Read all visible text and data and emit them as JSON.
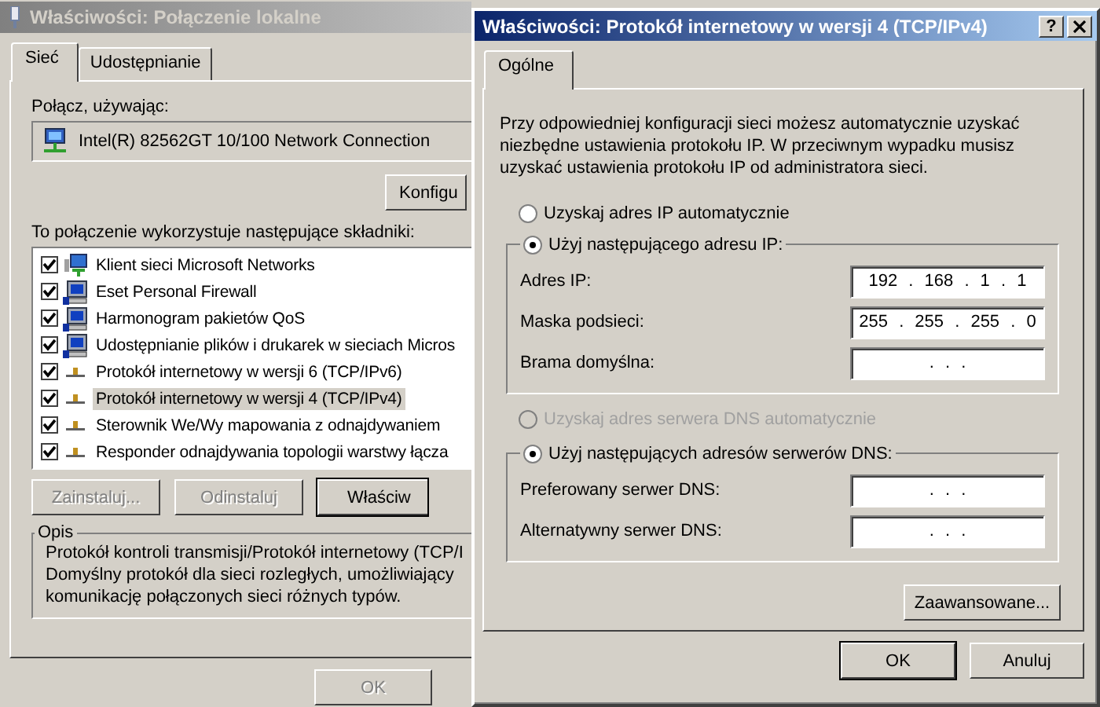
{
  "back_window": {
    "title": "Właściwości: Połączenie lokalne",
    "tabs": [
      {
        "label": "Sieć",
        "selected": true
      },
      {
        "label": "Udostępnianie",
        "selected": false
      }
    ],
    "connect_using_label": "Połącz, używając:",
    "adapter": "Intel(R) 82562GT 10/100 Network Connection",
    "configure_button": "Konfigu",
    "components_label": "To połączenie wykorzystuje następujące składniki:",
    "components": [
      {
        "kind": "client",
        "label": "Klient sieci Microsoft Networks",
        "checked": true,
        "selected": false
      },
      {
        "kind": "service",
        "label": "Eset Personal Firewall",
        "checked": true,
        "selected": false
      },
      {
        "kind": "service",
        "label": "Harmonogram pakietów QoS",
        "checked": true,
        "selected": false
      },
      {
        "kind": "service",
        "label": "Udostępnianie plików i drukarek w sieciach Micros",
        "checked": true,
        "selected": false
      },
      {
        "kind": "protocol",
        "label": "Protokół internetowy w wersji 6 (TCP/IPv6)",
        "checked": true,
        "selected": false
      },
      {
        "kind": "protocol",
        "label": "Protokół internetowy w wersji 4 (TCP/IPv4)",
        "checked": true,
        "selected": true
      },
      {
        "kind": "protocol",
        "label": "Sterownik We/Wy mapowania z odnajdywaniem",
        "checked": true,
        "selected": false
      },
      {
        "kind": "protocol",
        "label": "Responder odnajdywania topologii warstwy łącza",
        "checked": true,
        "selected": false
      }
    ],
    "buttons": [
      {
        "label": "Zainstaluj...",
        "disabled": true,
        "default": false
      },
      {
        "label": "Odinstaluj",
        "disabled": true,
        "default": false
      },
      {
        "label": "Właściw",
        "disabled": false,
        "default": true
      }
    ],
    "description": {
      "title": "Opis",
      "text": "Protokół kontroli transmisji/Protokół internetowy (TCP/I\nDomyślny protokół dla sieci rozległych, umożliwiający\nkomunikację połączonych sieci różnych typów."
    },
    "ok_button": {
      "label": "OK",
      "disabled": true
    }
  },
  "front_window": {
    "title": "Właściwości: Protokół internetowy w wersji 4 (TCP/IPv4)",
    "help_button": "?",
    "tabs": [
      {
        "label": "Ogólne",
        "selected": true
      }
    ],
    "intro": "Przy odpowiedniej konfiguracji sieci możesz automatycznie uzyskać\nniezbędne ustawienia protokołu IP. W przeciwnym wypadku musisz\nuzyskać ustawienia protokołu IP od administratora sieci.",
    "ip_auto": {
      "label": "Uzyskaj adres IP automatycznie",
      "selected": false,
      "disabled": false
    },
    "ip_manual": {
      "label": "Użyj następującego adresu IP:",
      "selected": true,
      "disabled": false,
      "fields": [
        {
          "label": "Adres IP:",
          "value": "192 . 168 . 1 . 1"
        },
        {
          "label": "Maska podsieci:",
          "value": "255 . 255 . 255 . 0"
        },
        {
          "label": "Brama domyślna:",
          "value": ". . ."
        }
      ]
    },
    "dns_auto": {
      "label": "Uzyskaj adres serwera DNS automatycznie",
      "selected": false,
      "disabled": true
    },
    "dns_manual": {
      "label": "Użyj następujących adresów serwerów DNS:",
      "selected": true,
      "disabled": false,
      "fields": [
        {
          "label": "Preferowany serwer DNS:",
          "value": ". . ."
        },
        {
          "label": "Alternatywny serwer DNS:",
          "value": ". . ."
        }
      ]
    },
    "advanced_button": "Zaawansowane...",
    "ok_button": "OK",
    "cancel_button": "Anuluj"
  }
}
